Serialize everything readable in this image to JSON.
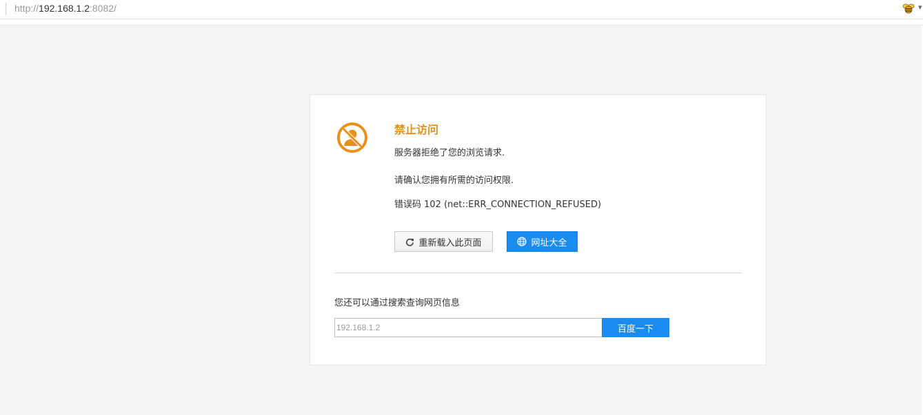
{
  "browser": {
    "url_scheme": "http://",
    "url_host": "192.168.1.2",
    "url_rest": ":8082/",
    "extension_icon": "bee-icon"
  },
  "error": {
    "icon": "no-access-icon",
    "title": "禁止访问",
    "line1": "服务器拒绝了您的浏览请求.",
    "line2": "请确认您拥有所需的访问权限.",
    "line3": "错误码 102 (net::ERR_CONNECTION_REFUSED)",
    "reload_label": "重新载入此页面",
    "sites_label": "网址大全"
  },
  "search": {
    "hint": "您还可以通过搜索查询网页信息",
    "value": "192.168.1.2",
    "button_label": "百度一下"
  },
  "colors": {
    "accent_orange": "#e8901a",
    "button_blue": "#1a8cf0"
  }
}
